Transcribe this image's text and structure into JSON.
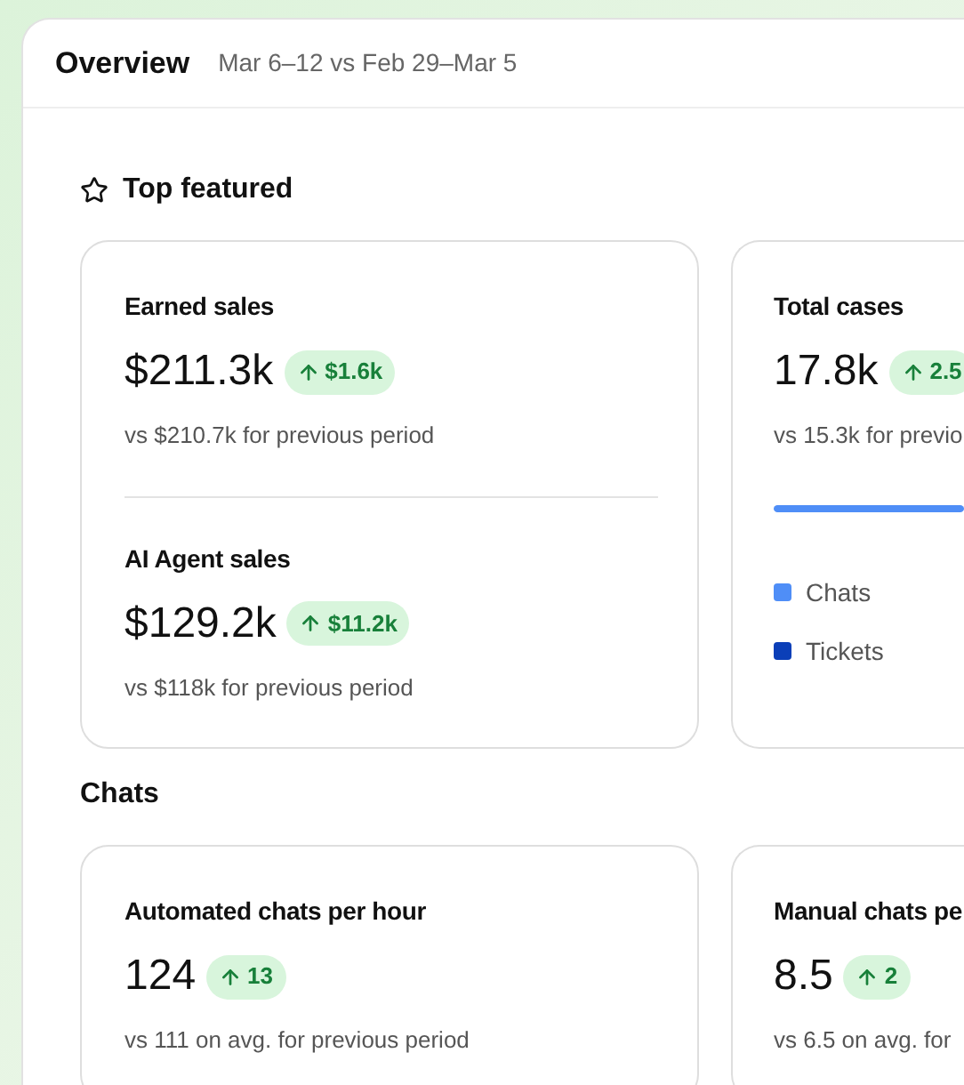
{
  "header": {
    "title": "Overview",
    "date_range": "Mar 6–12 vs Feb 29–Mar 5"
  },
  "sections": [
    {
      "kind": "featured",
      "title": "Top featured",
      "cards": [
        {
          "kind": "metrics",
          "metrics": [
            {
              "label": "Earned sales",
              "value": "$211.3k",
              "change": "$1.6k",
              "comparison": "vs $210.7k for previous period"
            },
            {
              "label": "AI Agent sales",
              "value": "$129.2k",
              "change": "$11.2k",
              "comparison": "vs $118k for previous period"
            }
          ]
        },
        {
          "kind": "breakdown",
          "metrics": [
            {
              "label": "Total cases",
              "value": "17.8k",
              "change": "2.5",
              "comparison": "vs 15.3k for previo"
            }
          ],
          "legend": [
            {
              "label": "Chats",
              "color": "#4f8ef7"
            },
            {
              "label": "Tickets",
              "color": "#0b3fb8"
            }
          ]
        }
      ]
    },
    {
      "kind": "plain",
      "title": "Chats",
      "cards": [
        {
          "kind": "metrics",
          "metrics": [
            {
              "label": "Automated chats per hour",
              "value": "124",
              "change": "13",
              "comparison": "vs 111 on avg. for previous period"
            }
          ]
        },
        {
          "kind": "metrics",
          "metrics": [
            {
              "label": "Manual chats pe",
              "value": "8.5",
              "change": "2",
              "comparison": "vs 6.5 on avg. for"
            }
          ]
        }
      ]
    }
  ]
}
